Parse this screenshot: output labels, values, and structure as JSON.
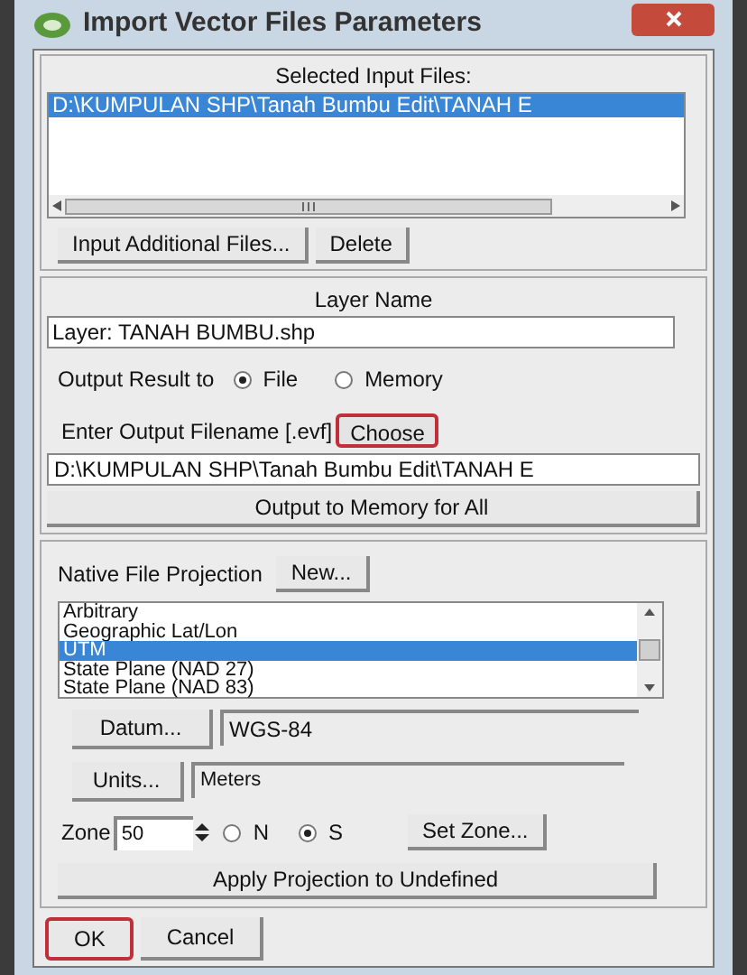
{
  "window": {
    "title": "Import Vector Files Parameters"
  },
  "input_files": {
    "heading": "Selected Input Files:",
    "files": [
      {
        "path": "D:\\KUMPULAN SHP\\Tanah Bumbu Edit\\TANAH E",
        "selected": true
      }
    ],
    "buttons": [
      "Input Additional Files...",
      "Delete"
    ]
  },
  "layer": {
    "heading": "Layer Name",
    "value": "Layer: TANAH BUMBU.shp"
  },
  "output": {
    "label": "Output Result to",
    "options": [
      {
        "label": "File",
        "selected": true
      },
      {
        "label": "Memory",
        "selected": false
      }
    ]
  },
  "filename": {
    "label": "Enter Output Filename [.evf]",
    "choose_button": {
      "label": "Choose",
      "highlighted": true
    },
    "value": "D:\\KUMPULAN SHP\\Tanah Bumbu Edit\\TANAH E",
    "memory_button": "Output to Memory for All"
  },
  "projection": {
    "label": "Native File Projection",
    "new_button": "New...",
    "options": [
      {
        "label": "Arbitrary",
        "selected": false
      },
      {
        "label": "Geographic Lat/Lon",
        "selected": false
      },
      {
        "label": "UTM",
        "selected": true
      },
      {
        "label": "State Plane (NAD 27)",
        "selected": false
      },
      {
        "label": "State Plane (NAD 83)",
        "selected": false
      }
    ],
    "datum_button": "Datum...",
    "datum_value": "WGS-84",
    "units_button": "Units...",
    "units_value": "Meters",
    "zone_label": "Zone",
    "zone_value": "50",
    "hemispheres": [
      {
        "label": "N",
        "selected": false
      },
      {
        "label": "S",
        "selected": true
      }
    ],
    "set_zone_button": "Set Zone...",
    "apply_button": "Apply Projection to Undefined"
  },
  "buttons": [
    {
      "label": "OK",
      "highlighted": true
    },
    {
      "label": "Cancel",
      "highlighted": false
    }
  ]
}
